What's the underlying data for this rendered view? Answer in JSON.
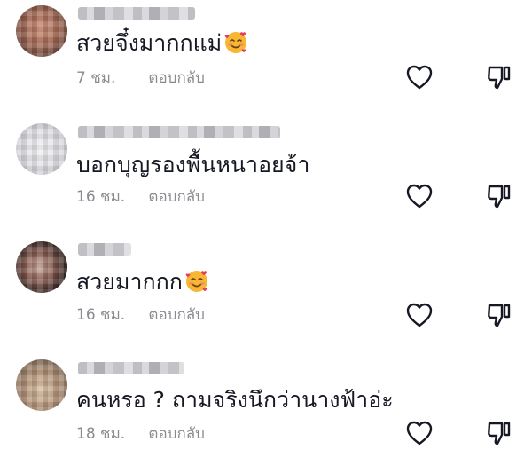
{
  "comments": [
    {
      "avatar": "avatar-blurred",
      "username": "",
      "text": "สวยจึ๋งมากกแม่",
      "emoji": "smiling-face-with-hearts-emoji",
      "time": "7 ชม.",
      "reply_label": "ตอบกลับ",
      "like_icon": "heart-outline-icon",
      "dislike_icon": "thumbs-down-icon"
    },
    {
      "avatar": "avatar-blurred",
      "username": "",
      "text": "บอกบุญรองพื้นหนาอยจ้า",
      "emoji": "",
      "time": "16 ชม.",
      "reply_label": "ตอบกลับ",
      "like_icon": "heart-outline-icon",
      "dislike_icon": "thumbs-down-icon"
    },
    {
      "avatar": "avatar-blurred",
      "username": "",
      "text": "สวยมากกก",
      "emoji": "smiling-face-with-hearts-emoji",
      "time": "16 ชม.",
      "reply_label": "ตอบกลับ",
      "like_icon": "heart-outline-icon",
      "dislike_icon": "thumbs-down-icon"
    },
    {
      "avatar": "avatar-blurred",
      "username": "",
      "text": "คนหรอ ? ถามจริงนึกว่านางฟ้าอ่ะ",
      "emoji": "",
      "time": "18 ชม.",
      "reply_label": "ตอบกลับ",
      "like_icon": "heart-outline-icon",
      "dislike_icon": "thumbs-down-icon"
    }
  ],
  "colors": {
    "text_primary": "#161823",
    "text_secondary": "#8a8b91",
    "icon": "#161823",
    "emoji_face": "#f7b733",
    "emoji_heart": "#ea3d5c",
    "emoji_cheek": "#f08a6a"
  }
}
